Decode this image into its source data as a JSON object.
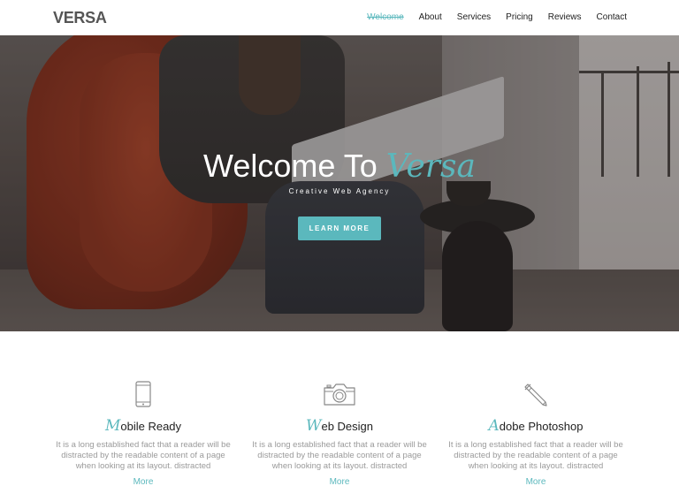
{
  "brand": {
    "logo": "VERSA",
    "accent_color": "#5bb8bd"
  },
  "nav": {
    "items": [
      {
        "label": "Welcome",
        "active": true
      },
      {
        "label": "About",
        "active": false
      },
      {
        "label": "Services",
        "active": false
      },
      {
        "label": "Pricing",
        "active": false
      },
      {
        "label": "Reviews",
        "active": false
      },
      {
        "label": "Contact",
        "active": false
      }
    ]
  },
  "hero": {
    "title_prefix": "Welcome To ",
    "title_accent": "Versa",
    "subtitle": "Creative Web Agency",
    "button_label": "LEARN MORE"
  },
  "features": [
    {
      "icon": "mobile-icon",
      "title_first": "M",
      "title_rest": "obile Ready",
      "text": "It is a long established fact that a reader will be distracted by the readable content of a page when looking at its layout. distracted",
      "link": "More"
    },
    {
      "icon": "camera-icon",
      "title_first": "W",
      "title_rest": "eb Design",
      "text": "It is a long established fact that a reader will be distracted by the readable content of a page when looking at its layout. distracted",
      "link": "More"
    },
    {
      "icon": "pencil-icon",
      "title_first": "A",
      "title_rest": "dobe Photoshop",
      "text": "It is a long established fact that a reader will be distracted by the readable content of a page when looking at its layout. distracted",
      "link": "More"
    }
  ]
}
